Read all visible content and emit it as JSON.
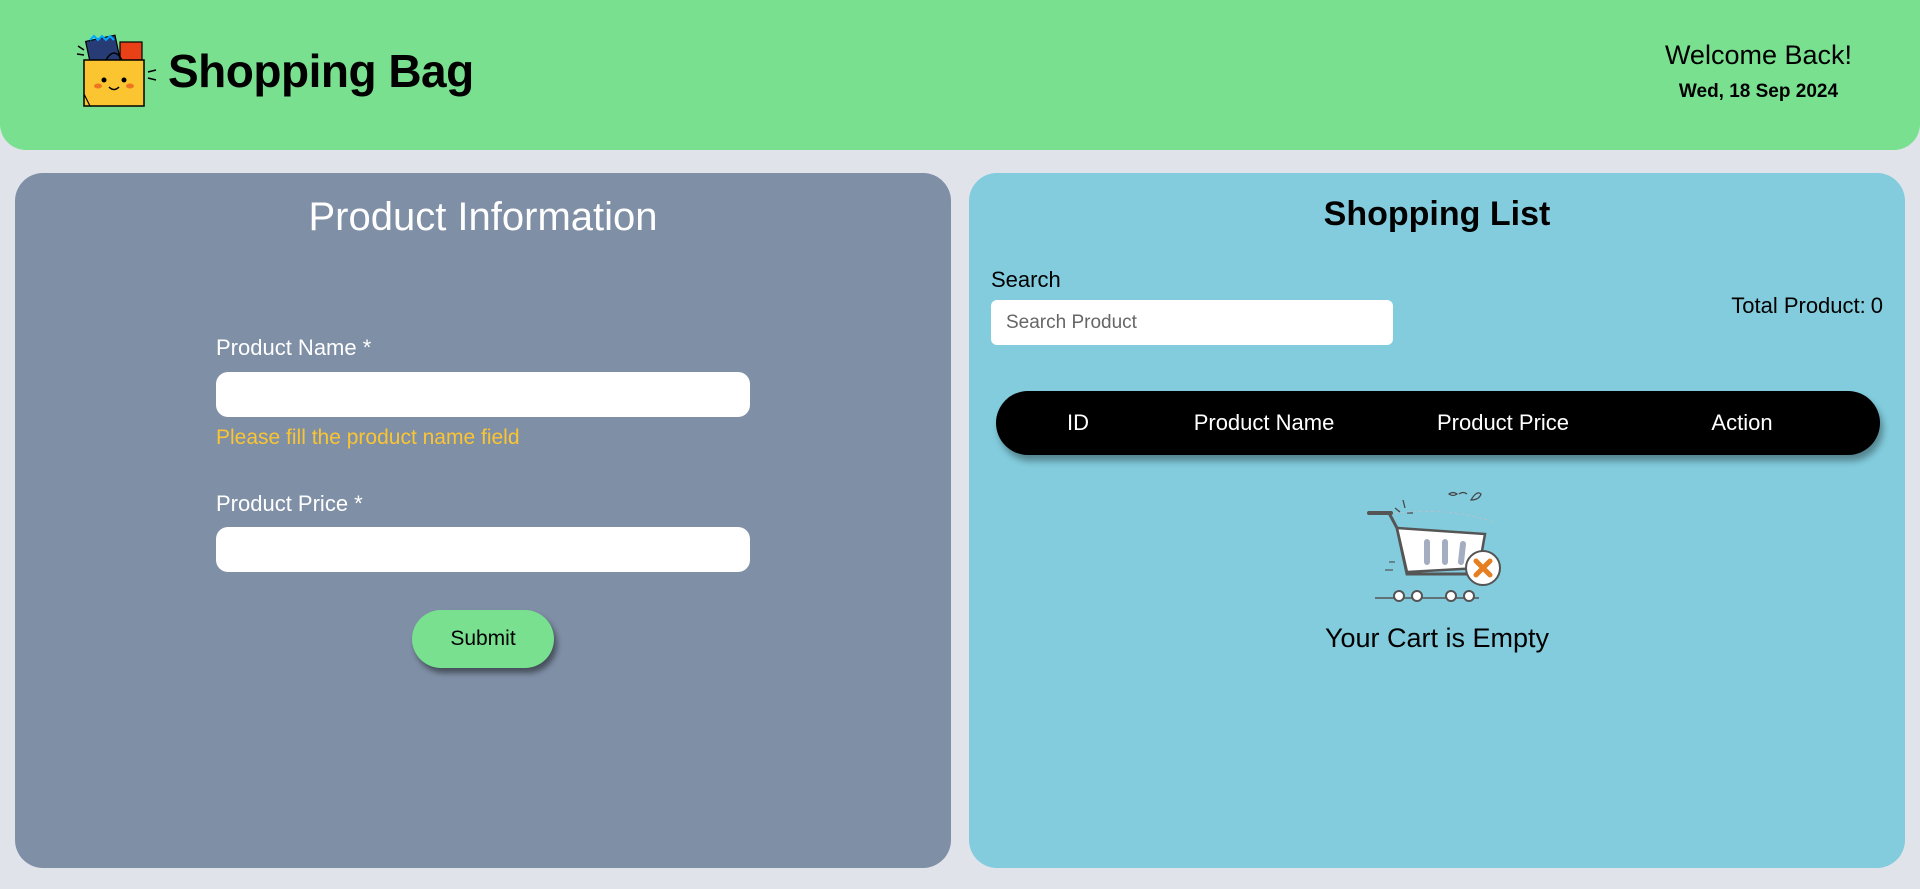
{
  "header": {
    "app_title": "Shopping Bag",
    "logo_icon": "shopping-bag-icon",
    "welcome": "Welcome Back!",
    "date": "Wed, 18 Sep 2024",
    "background": "#78e08f"
  },
  "form": {
    "title": "Product Information",
    "product_name_label": "Product Name *",
    "product_name_value": "",
    "product_name_error": "Please fill the product name field",
    "product_price_label": "Product Price *",
    "product_price_value": "",
    "submit_label": "Submit",
    "panel_color": "#7f8fa6",
    "error_color": "#fbc531"
  },
  "list": {
    "title": "Shopping List",
    "search_label": "Search",
    "search_placeholder": "Search Product",
    "total_label": "Total Product:",
    "total_count": "0",
    "columns": [
      "ID",
      "Product Name",
      "Product Price",
      "Action"
    ],
    "empty_icon": "empty-cart-icon",
    "empty_message": "Your Cart is Empty",
    "panel_color": "#82ccdd"
  }
}
